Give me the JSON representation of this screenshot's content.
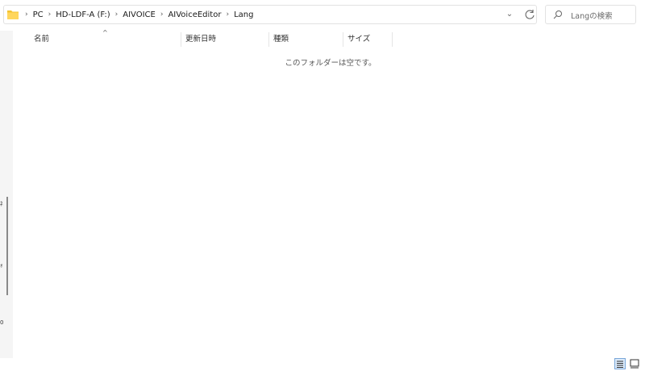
{
  "address": {
    "breadcrumbs": [
      "PC",
      "HD-LDF-A (F:)",
      "AIVOICE",
      "AIVoiceEditor",
      "Lang"
    ],
    "dropdown_glyph": "⌄"
  },
  "search": {
    "placeholder": "Langの検索"
  },
  "columns": [
    "名前",
    "更新日時",
    "種類",
    "サイズ"
  ],
  "sort_glyph": "^",
  "empty_message": "このフォルダーは空です。",
  "nav_glyphs": [
    "ﾈ",
    "ｫ",
    "0"
  ],
  "icons": {
    "folder": "folder-icon",
    "chevron": "chevron-right-icon",
    "dropdown": "chevron-down-icon",
    "refresh": "refresh-icon",
    "search": "search-icon",
    "details_view": "details-view-icon",
    "tiles_view": "tiles-view-icon"
  },
  "colors": {
    "folder": "#f4c430",
    "selected_view": "#d9e8f8",
    "accent": "#0078d4"
  }
}
